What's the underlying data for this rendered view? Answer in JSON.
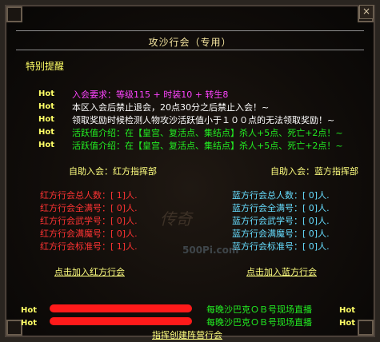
{
  "window": {
    "title": "攻沙行会（专用）",
    "close_label": "×"
  },
  "notice": "特别提醒",
  "hot_label": "Hot",
  "hot_lines": [
    {
      "text": "入会要求：等级115 + 时装10 + 转生8",
      "color": "pink"
    },
    {
      "text": "本区入会后禁止退会，20点30分之后禁止入会！~",
      "color": "white"
    },
    {
      "text": "领取奖励时候检测人物攻沙活跃值小于１００点的无法领取奖励！~",
      "color": "white"
    },
    {
      "text": "活跃值介绍：在【皇宫、复活点、集结点】杀人+5点、死亡+2点！~",
      "color": "green"
    },
    {
      "text": "活跃值介绍：在【皇宫、复活点、集结点】杀人+5点、死亡+2点！~",
      "color": "green"
    }
  ],
  "red_team": {
    "auto_join": "自助入会：红方指挥部",
    "stats": [
      "红方行会总人数：[  1]人.",
      "红方行会全满号：[  0]人.",
      "红方行会武学号：[  0]人.",
      "红方行会满魔号：[  0]人.",
      "红方行会标准号：[  1]人."
    ],
    "join_link": "点击加入红方行会"
  },
  "blue_team": {
    "auto_join": "自助入会：蓝方指挥部",
    "stats": [
      "蓝方行会总人数：[  0]人.",
      "蓝方行会全满号：[  0]人.",
      "蓝方行会武学号：[  0]人.",
      "蓝方行会满魔号：[  0]人.",
      "蓝方行会标准号：[  0]人."
    ],
    "join_link": "点击加入蓝方行会"
  },
  "watermark": {
    "text": "传奇",
    "site": "500Pi.com"
  },
  "live": [
    {
      "text": "每晚沙巴克ＯＢ号现场直播"
    },
    {
      "text": "每晚沙巴克ＯＢ号现场直播"
    }
  ],
  "footer_link": "指挥创建阵营行会"
}
